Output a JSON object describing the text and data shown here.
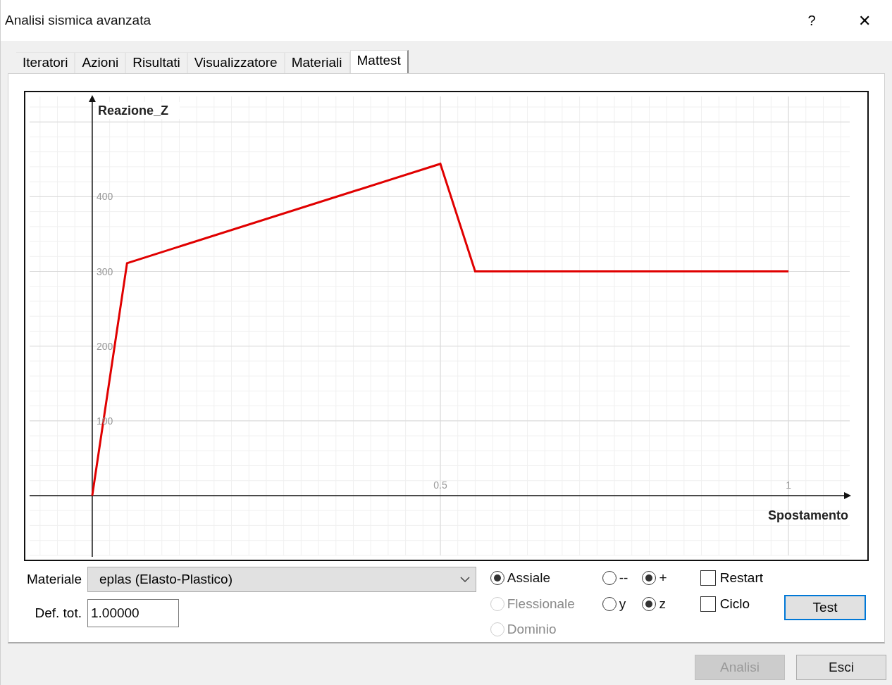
{
  "window": {
    "title": "Analisi sismica avanzata",
    "help": "?",
    "close": "✕"
  },
  "tabs": [
    {
      "label": "Iteratori",
      "selected": false
    },
    {
      "label": "Azioni",
      "selected": false
    },
    {
      "label": "Risultati",
      "selected": false
    },
    {
      "label": "Visualizzatore",
      "selected": false
    },
    {
      "label": "Materiali",
      "selected": false
    },
    {
      "label": "Mattest",
      "selected": true
    }
  ],
  "chart": {
    "chart_data": {
      "type": "line",
      "xlabel": "Spostamento",
      "ylabel": "Reazione_Z",
      "x": [
        0,
        0.05,
        0.5,
        0.55,
        1
      ],
      "series": [
        {
          "color": "#e00000",
          "values": [
            0,
            311,
            444,
            300,
            300
          ]
        }
      ],
      "grid": true,
      "xlim": [
        -0.09,
        1.09
      ],
      "ylim": [
        -82,
        536
      ],
      "xticks": [
        0.5,
        1
      ],
      "yticks": [
        100,
        200,
        300,
        400
      ]
    }
  },
  "material": {
    "label": "Materiale",
    "value": "eplas (Elasto-Plastico)"
  },
  "def_tot": {
    "label": "Def. tot.",
    "value": "1.00000"
  },
  "analysis_types": [
    {
      "label": "Assiale",
      "selected": true,
      "disabled": false
    },
    {
      "label": "Flessionale",
      "selected": false,
      "disabled": true
    },
    {
      "label": "Dominio",
      "selected": false,
      "disabled": true
    }
  ],
  "sign_options": [
    {
      "label": "--",
      "selected": false
    },
    {
      "label": "+",
      "selected": true
    }
  ],
  "axis_options": [
    {
      "label": "y",
      "selected": false
    },
    {
      "label": "z",
      "selected": true
    }
  ],
  "checkboxes": [
    {
      "label": "Restart",
      "checked": false
    },
    {
      "label": "Ciclo",
      "checked": false
    }
  ],
  "test_button": {
    "label": "Test",
    "focused": true
  },
  "footer_buttons": [
    {
      "label": "Analisi",
      "disabled": true
    },
    {
      "label": "Esci",
      "disabled": false
    }
  ]
}
